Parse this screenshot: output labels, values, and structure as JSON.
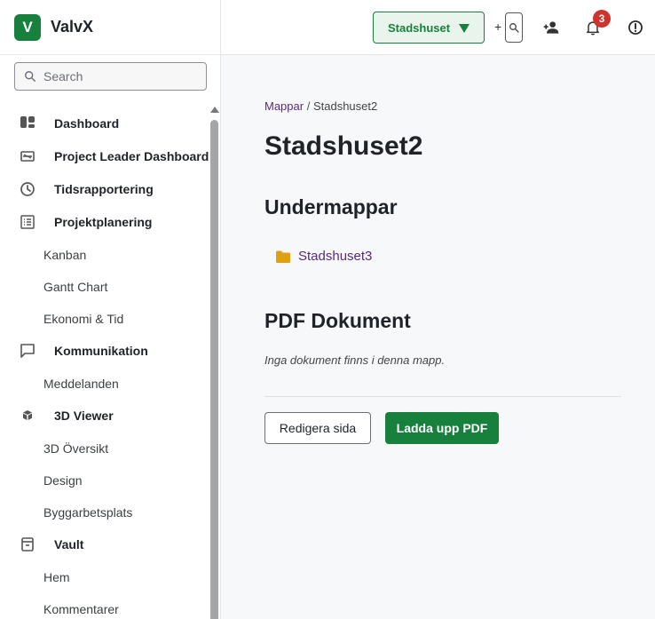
{
  "brand": {
    "logo_letter": "V",
    "name": "ValvX"
  },
  "search": {
    "placeholder": "Search"
  },
  "sidebar": {
    "items": [
      {
        "label": "Dashboard",
        "type": "main",
        "icon": "dashboard-icon"
      },
      {
        "label": "Project Leader Dashboard",
        "type": "main",
        "icon": "leader-dashboard-icon"
      },
      {
        "label": "Tidsrapportering",
        "type": "main",
        "icon": "clock-icon"
      },
      {
        "label": "Projektplanering",
        "type": "main",
        "icon": "list-icon"
      },
      {
        "label": "Kanban",
        "type": "sub"
      },
      {
        "label": "Gantt Chart",
        "type": "sub"
      },
      {
        "label": "Ekonomi & Tid",
        "type": "sub"
      },
      {
        "label": "Kommunikation",
        "type": "main",
        "icon": "chat-icon"
      },
      {
        "label": "Meddelanden",
        "type": "sub"
      },
      {
        "label": "3D Viewer",
        "type": "main",
        "icon": "cube-icon"
      },
      {
        "label": "3D Översikt",
        "type": "sub"
      },
      {
        "label": "Design",
        "type": "sub"
      },
      {
        "label": "Byggarbetsplats",
        "type": "sub"
      },
      {
        "label": "Vault",
        "type": "main",
        "icon": "vault-icon"
      },
      {
        "label": "Hem",
        "type": "sub"
      },
      {
        "label": "Kommentarer",
        "type": "sub"
      }
    ]
  },
  "topbar": {
    "project_select": "Stadshuset",
    "plus": "+",
    "notification_count": "3",
    "icons": [
      "search-icon",
      "add-user-icon",
      "bell-icon",
      "alert-icon"
    ]
  },
  "breadcrumb": {
    "root": "Mappar",
    "separator": "/",
    "current": "Stadshuset2"
  },
  "page": {
    "title": "Stadshuset2",
    "subfolders_heading": "Undermappar",
    "subfolders": [
      "Stadshuset3"
    ],
    "pdf_heading": "PDF Dokument",
    "pdf_empty": "Inga dokument finns i denna mapp.",
    "edit_button": "Redigera sida",
    "upload_button": "Ladda upp PDF"
  },
  "colors": {
    "brand_green": "#17803d",
    "link_purple": "#5a2a7a",
    "badge_red": "#d0332c",
    "folder_yellow": "#e0a010"
  }
}
